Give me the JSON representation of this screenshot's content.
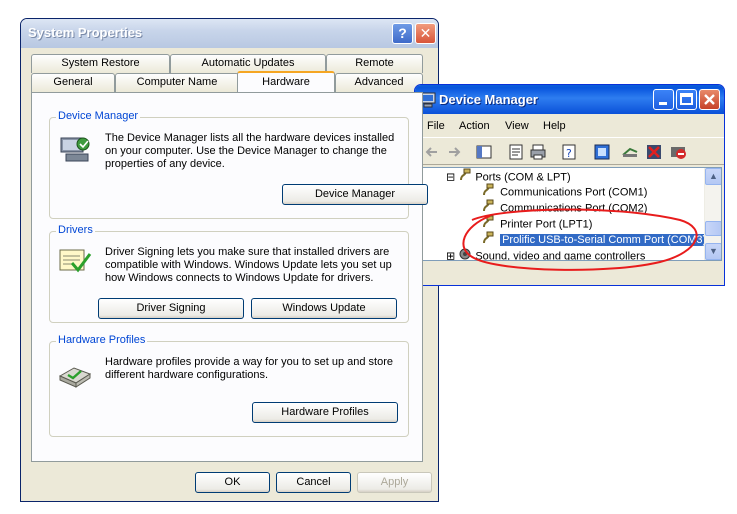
{
  "system_properties": {
    "title": "System Properties",
    "help_glyph": "?",
    "close_glyph": "✕",
    "tabs_row1": [
      "System Restore",
      "Automatic Updates",
      "Remote"
    ],
    "tabs_row2": [
      "General",
      "Computer Name",
      "Hardware",
      "Advanced"
    ],
    "active_tab": "Hardware",
    "device_manager_group": {
      "label": "Device Manager",
      "text": "The Device Manager lists all the hardware devices installed on your computer. Use the Device Manager to change the properties of any device.",
      "button": "Device Manager"
    },
    "drivers_group": {
      "label": "Drivers",
      "text": "Driver Signing lets you make sure that installed drivers are compatible with Windows. Windows Update lets you set up how Windows connects to Windows Update for drivers.",
      "button_signing": "Driver Signing",
      "button_update": "Windows Update"
    },
    "hardware_profiles_group": {
      "label": "Hardware Profiles",
      "text": "Hardware profiles provide a way for you to set up and store different hardware configurations.",
      "button": "Hardware Profiles"
    },
    "ok_label": "OK",
    "cancel_label": "Cancel",
    "apply_label": "Apply"
  },
  "device_manager": {
    "title": "Device Manager",
    "menu": [
      "File",
      "Action",
      "View",
      "Help"
    ],
    "toolbar_icons": [
      "back-icon",
      "forward-icon",
      "console-tree-icon",
      "properties-icon",
      "print-icon",
      "help-icon",
      "scan-icon",
      "update-driver-icon",
      "uninstall-icon",
      "disable-icon"
    ],
    "tree": {
      "expander": "⊟",
      "collapsed_expander": "⊞",
      "ports_category": "Ports (COM & LPT)",
      "items": [
        "Communications Port (COM1)",
        "Communications Port (COM2)",
        "Printer Port (LPT1)",
        "Prolific USB-to-Serial Comm Port (COM3)"
      ],
      "selected_item": "Prolific USB-to-Serial Comm Port (COM3)",
      "next_category": "Sound, video and game controllers"
    },
    "scroll_up": "▲",
    "scroll_down": "▼"
  },
  "colors": {
    "annotation_circle": "#e81c1c",
    "selection": "#316ac5",
    "group_label": "#0046d5",
    "xp_blue_title": "#0a5fd8"
  }
}
